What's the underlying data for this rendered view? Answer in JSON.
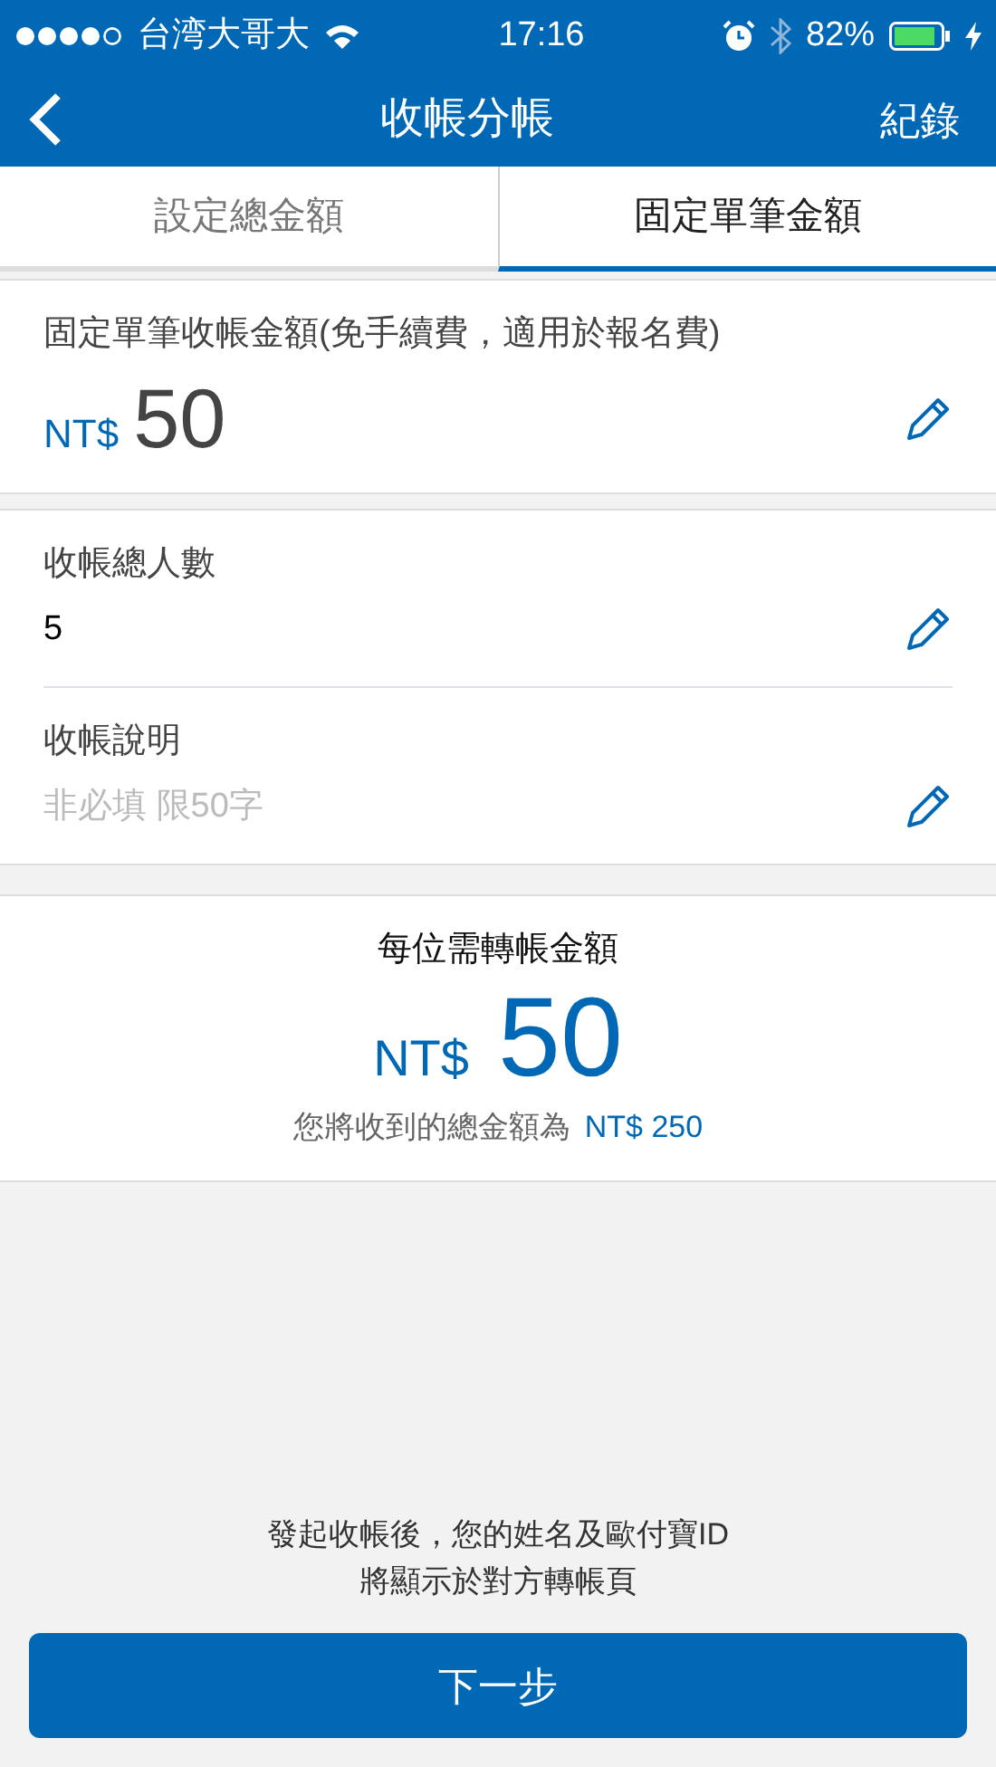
{
  "status_bar": {
    "carrier": "台湾大哥大",
    "time": "17:16",
    "battery": "82%"
  },
  "nav": {
    "title": "收帳分帳",
    "action": "紀錄"
  },
  "tabs": [
    {
      "label": "設定總金額",
      "selected": false
    },
    {
      "label": "固定單筆金額",
      "selected": true
    }
  ],
  "amount_card": {
    "label": "固定單筆收帳金額(免手續費，適用於報名費)",
    "currency": "NT$",
    "value": "50"
  },
  "fields": [
    {
      "label": "收帳總人數",
      "value": "5"
    },
    {
      "label": "收帳說明",
      "placeholder": "非必填 限50字"
    }
  ],
  "summary": {
    "title": "每位需轉帳金額",
    "currency": "NT$",
    "amount": "50",
    "total_label": "您將收到的總金額為",
    "total_value": "NT$ 250"
  },
  "notice": [
    "發起收帳後，您的姓名及歐付寶ID",
    "將顯示於對方轉帳頁"
  ],
  "next_button": "下一步"
}
